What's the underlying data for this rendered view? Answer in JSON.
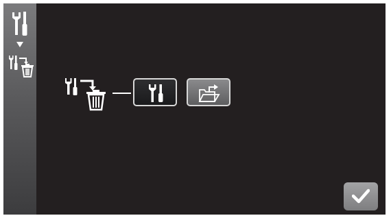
{
  "sidebar": {
    "icons": [
      "tools-icon",
      "down-arrow-icon",
      "tools-to-trash-icon"
    ]
  },
  "main": {
    "action_icon": "tools-to-trash-icon",
    "buttons": [
      {
        "icon": "tools-icon",
        "style": "dark"
      },
      {
        "icon": "folder-export-icon",
        "style": "grey"
      }
    ]
  },
  "confirm": {
    "icon": "checkmark-icon"
  },
  "colors": {
    "screen_bg": "#231f20",
    "icon": "#ffffff",
    "button_border": "#d8d8d8"
  }
}
